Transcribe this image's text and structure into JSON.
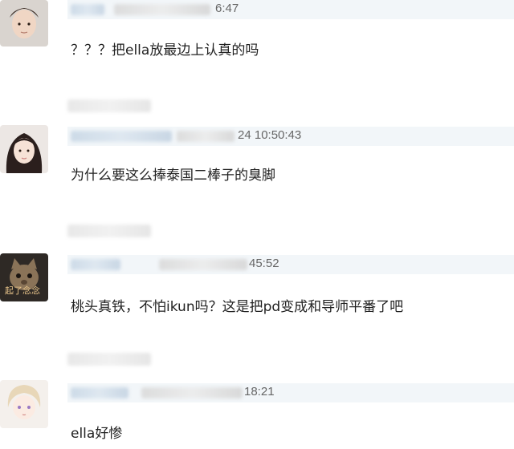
{
  "comments": [
    {
      "timestamp": "6:47",
      "text": "？？？把ella放最边上认真的吗",
      "avatar_icon": "avatar-young-man-icon"
    },
    {
      "timestamp": "24 10:50:43",
      "text": "为什么要这么捧泰国二棒子的臭脚",
      "avatar_icon": "avatar-girl-icon"
    },
    {
      "timestamp": "45:52",
      "text": "桃头真铁，不怕ikun吗？这是把pd变成和导师平番了吧",
      "avatar_icon": "avatar-cat-icon",
      "avatar_caption": "起了念念"
    },
    {
      "timestamp": "18:21",
      "text": "ella好惨",
      "avatar_icon": "avatar-anime-boy-icon"
    }
  ],
  "colors": {
    "meta_bar_bg": "#f2f6f9",
    "text": "#222222",
    "timestamp": "#666666"
  }
}
